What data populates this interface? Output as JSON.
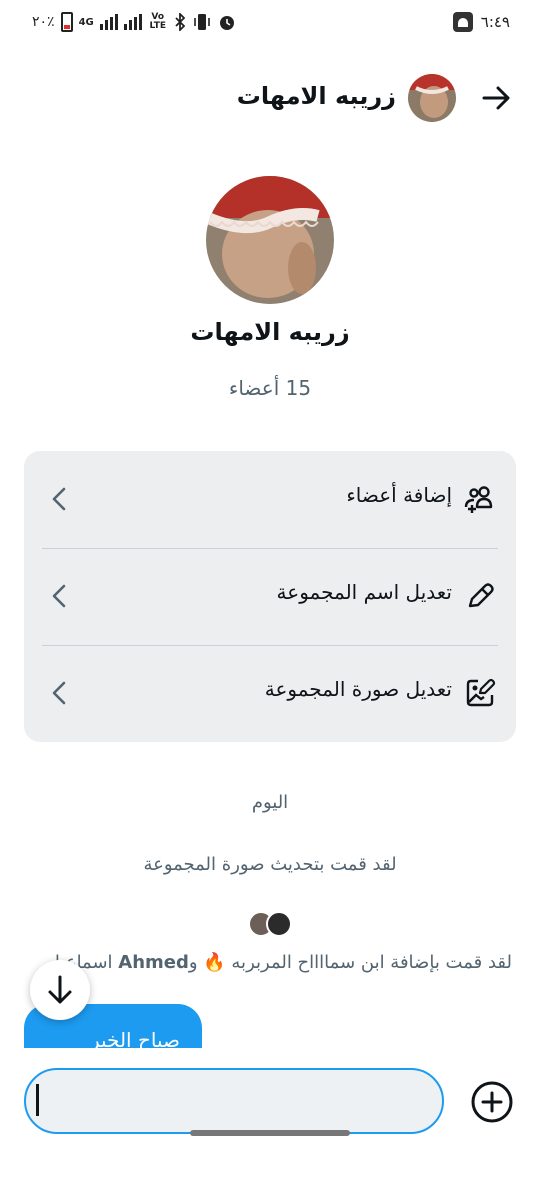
{
  "status_bar": {
    "battery_text": "٢٠٪",
    "network_label": "4G",
    "volte_label": "Vo LTE",
    "time": "٦:٤٩"
  },
  "header": {
    "title": "زريبه الامهات",
    "back_icon": "arrow-right-icon"
  },
  "group": {
    "name": "زريبه الامهات",
    "member_count": "15 أعضاء"
  },
  "menu": [
    {
      "label": "إضافة أعضاء",
      "icon": "add-members-icon"
    },
    {
      "label": "تعديل اسم المجموعة",
      "icon": "pencil-icon"
    },
    {
      "label": "تعديل صورة المجموعة",
      "icon": "edit-image-icon"
    }
  ],
  "timeline": {
    "day_label": "اليوم",
    "event_photo_update": "لقد قمت بتحديث صورة المجموعة",
    "event_added_prefix": "لقد قمت بإضافة ابن سمااااح المربربه 🔥 و",
    "event_added_name": "Ahmed",
    "event_added_suffix": " اسماعيل"
  },
  "message_preview": {
    "text": "صباح الخير"
  },
  "composer": {
    "value": ""
  },
  "colors": {
    "accent": "#1d9bf0",
    "card_bg": "#eceef0",
    "secondary_text": "#536471"
  }
}
